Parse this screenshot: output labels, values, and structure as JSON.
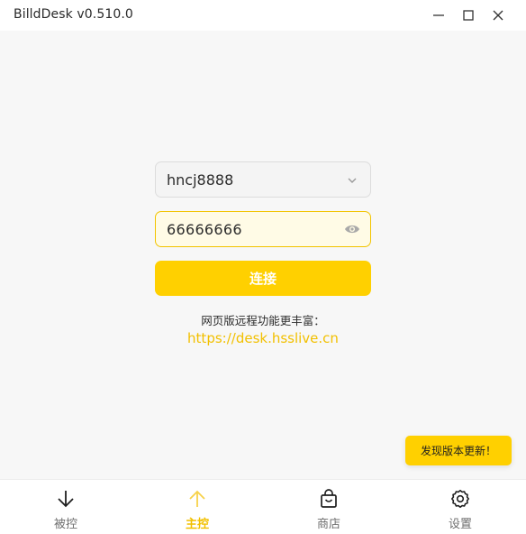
{
  "window": {
    "title": "BilldDesk v0.510.0"
  },
  "login": {
    "account_value": "hncj8888",
    "password_value": "66666666",
    "connect_label": "连接",
    "hint_text": "网页版远程功能更丰富：",
    "web_link": "https://desk.hsslive.cn"
  },
  "toast": {
    "text": "发现版本更新！"
  },
  "nav": {
    "items": [
      {
        "label": "被控",
        "icon": "arrow-down-icon",
        "active": false
      },
      {
        "label": "主控",
        "icon": "arrow-up-icon",
        "active": true
      },
      {
        "label": "商店",
        "icon": "shopping-bag-icon",
        "active": false
      },
      {
        "label": "设置",
        "icon": "gear-icon",
        "active": false
      }
    ]
  },
  "colors": {
    "accent": "#ffd000",
    "link": "#f2c000",
    "background": "#f7f7f7"
  }
}
